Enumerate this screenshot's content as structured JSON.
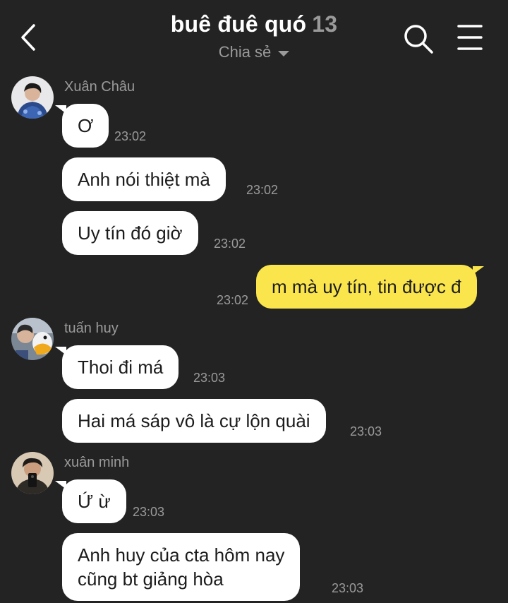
{
  "header": {
    "title": "buê đuê quó",
    "member_count": "13",
    "subtitle": "Chia sẻ"
  },
  "messages": [
    {
      "sender": "Xuân Châu",
      "text": "Ơ",
      "time": "23:02"
    },
    {
      "text": "Anh nói thiệt mà",
      "time": "23:02"
    },
    {
      "text": "Uy tín đó giờ",
      "time": "23:02"
    },
    {
      "mine": true,
      "text": "m mà uy tín, tin được đ",
      "time": "23:02"
    },
    {
      "sender": "tuấn huy",
      "text": "Thoi đi má",
      "time": "23:03"
    },
    {
      "text": "Hai má sáp vô là cự lộn quài",
      "time": "23:03"
    },
    {
      "sender": "xuân minh",
      "text": "Ứ ừ",
      "time": "23:03"
    },
    {
      "text_line1": "Anh huy của cta hôm nay",
      "text_line2": "cũng bt giảng hòa",
      "time": "23:03"
    }
  ],
  "colors": {
    "background": "#232323",
    "bubble_other": "#ffffff",
    "bubble_mine": "#fae54d",
    "muted_text": "#9a9a9a"
  },
  "icons": [
    "chevron-left-icon",
    "search-icon",
    "hamburger-menu-icon",
    "caret-down-icon"
  ]
}
